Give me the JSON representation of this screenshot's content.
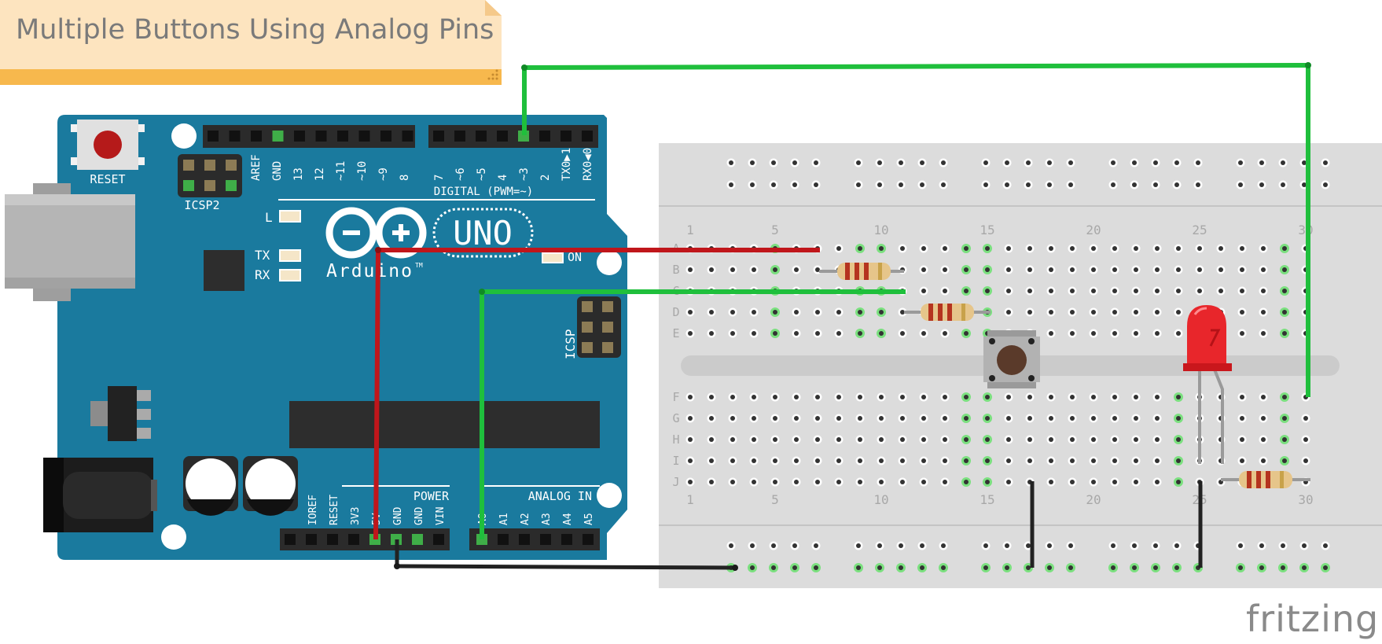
{
  "note": {
    "title": "Multiple Buttons Using Analog Pins"
  },
  "arduino": {
    "reset_label": "RESET",
    "icsp2_label": "ICSP2",
    "icsp_label": "ICSP",
    "digital_label": "DIGITAL (PWM=~)",
    "digital_pins_left": [
      "AREF",
      "GND",
      "13",
      "12",
      "~11",
      "~10",
      "~9",
      "8"
    ],
    "digital_pins_right": [
      "7",
      "~6",
      "~5",
      "4",
      "~3",
      "2",
      "TX0▶1",
      "RX0◀0"
    ],
    "led_l": "L",
    "led_tx": "TX",
    "led_rx": "RX",
    "led_on": "ON",
    "brand": "Arduino",
    "tm": "TM",
    "model": "UNO",
    "power_label": "POWER",
    "analog_label": "ANALOG IN",
    "power_pins": [
      "IOREF",
      "RESET",
      "3V3",
      "5V",
      "GND",
      "GND",
      "VIN"
    ],
    "analog_pins": [
      "A0",
      "A1",
      "A2",
      "A3",
      "A4",
      "A5"
    ]
  },
  "breadboard": {
    "column_numbers": [
      "1",
      "5",
      "10",
      "15",
      "20",
      "25",
      "30"
    ],
    "rows_top": [
      "A",
      "B",
      "C",
      "D",
      "E"
    ],
    "rows_bottom": [
      "F",
      "G",
      "H",
      "I",
      "J"
    ]
  },
  "watermark": "fritzing",
  "colors": {
    "board": "#1a7a9e",
    "wire_green": "#1fbf3c",
    "wire_red": "#c0161b",
    "wire_black": "#222222",
    "breadboard": "#dcdcdc",
    "note_body": "#fde4bf",
    "note_bar": "#f7b84d",
    "led": "#e8262b"
  },
  "icons": [
    "usb-connector-icon",
    "power-jack-icon",
    "capacitor-icon",
    "resistor-icon",
    "pushbutton-icon",
    "led-icon"
  ]
}
